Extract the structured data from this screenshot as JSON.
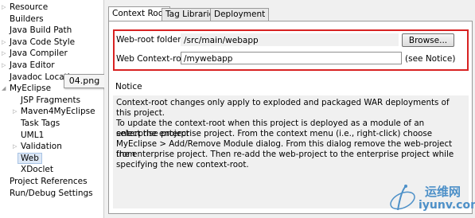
{
  "tree": {
    "items": [
      {
        "label": "Resource",
        "expandable": true
      },
      {
        "label": "Builders",
        "expandable": false
      },
      {
        "label": "Java Build Path",
        "expandable": false
      },
      {
        "label": "Java Code Style",
        "expandable": true
      },
      {
        "label": "Java Compiler",
        "expandable": true
      },
      {
        "label": "Java Editor",
        "expandable": true
      },
      {
        "label": "Javadoc Locatio",
        "expandable": false
      },
      {
        "label": "MyEclipse",
        "expandable": true,
        "expanded": true
      },
      {
        "label": "JSP Fragments",
        "expandable": false
      },
      {
        "label": "Maven4MyEclipse",
        "expandable": true
      },
      {
        "label": "Task Tags",
        "expandable": false
      },
      {
        "label": "UML1",
        "expandable": false
      },
      {
        "label": "Validation",
        "expandable": true
      },
      {
        "label": "Web",
        "expandable": false,
        "selected": true
      },
      {
        "label": "XDoclet",
        "expandable": false
      },
      {
        "label": "Project References",
        "expandable": false
      },
      {
        "label": "Run/Debug Settings",
        "expandable": false
      }
    ]
  },
  "tooltip": {
    "text": "04.png"
  },
  "tabs": [
    {
      "label": "Context Root",
      "active": true
    },
    {
      "label": "Tag Libraries",
      "active": false
    },
    {
      "label": "Deployment",
      "active": false
    }
  ],
  "form": {
    "webroot_label": "Web-root folder:",
    "webroot_value": "/src/main/webapp",
    "browse_label": "Browse...",
    "context_label": "Web Context-root:",
    "context_value": "/mywebapp",
    "see_notice": "(see Notice)"
  },
  "notice": {
    "title": "Notice",
    "p1": "Context-root changes only apply to exploded and packaged WAR deployments of this project.",
    "p2_lines": [
      "To update the context-root when this project is deployed as a module of an enterprise project",
      "select the enterprise project. From the context menu (i.e., right-click) choose",
      "MyEclipse > Add/Remove Module dialog. From this dialog remove the web-project from",
      "the enterprise project. Then re-add the web-project to the enterprise project while",
      "specifying the new context-root."
    ]
  },
  "watermark": {
    "cn": "运维网",
    "en": "iyunv.com"
  },
  "colors": {
    "highlight_border": "#d82222",
    "selection": "#dde8f6",
    "watermark": "#4d90c8"
  }
}
